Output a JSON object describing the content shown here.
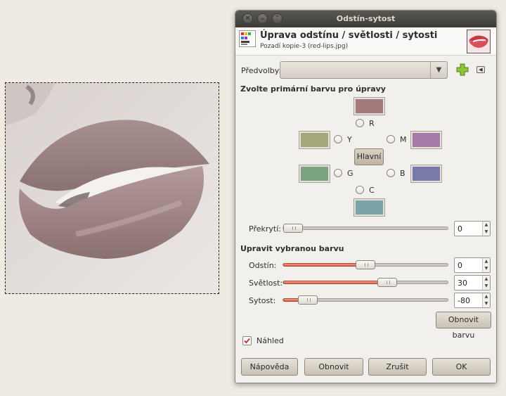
{
  "dialog": {
    "title": "Odstín-sytost",
    "header_title": "Úprava odstínu / světlosti / sytosti",
    "header_subtitle": "Pozadí kopie-3 (red-lips.jpg)",
    "presets_label": "Předvolby:",
    "primary_section": "Zvolte primární barvu pro úpravy",
    "colors": {
      "R": {
        "label": "R",
        "hex": "#a47a7c"
      },
      "Y": {
        "label": "Y",
        "hex": "#a3a77a"
      },
      "M": {
        "label": "M",
        "hex": "#a57ba9"
      },
      "G": {
        "label": "G",
        "hex": "#7ba47e"
      },
      "B": {
        "label": "B",
        "hex": "#7a7aa8"
      },
      "C": {
        "label": "C",
        "hex": "#7aa4a5"
      }
    },
    "master_button": "Hlavní",
    "overlap_label": "Překrytí:",
    "overlap_value": "0",
    "overlap_level": 0,
    "adjust_section": "Upravit vybranou barvu",
    "hue_label": "Odstín:",
    "hue_value": "0",
    "hue_level": 0.5,
    "lightness_label": "Světlost:",
    "lightness_value": "30",
    "lightness_level": 0.65,
    "saturation_label": "Sytost:",
    "saturation_value": "-80",
    "saturation_level": 0.1,
    "reset_color_button": "Obnovit barvu",
    "preview_label": "Náhled",
    "preview_checked": true,
    "buttons": {
      "help": "Nápověda",
      "reset": "Obnovit",
      "cancel": "Zrušit",
      "ok": "OK"
    },
    "accent_color": "#d95c48"
  }
}
